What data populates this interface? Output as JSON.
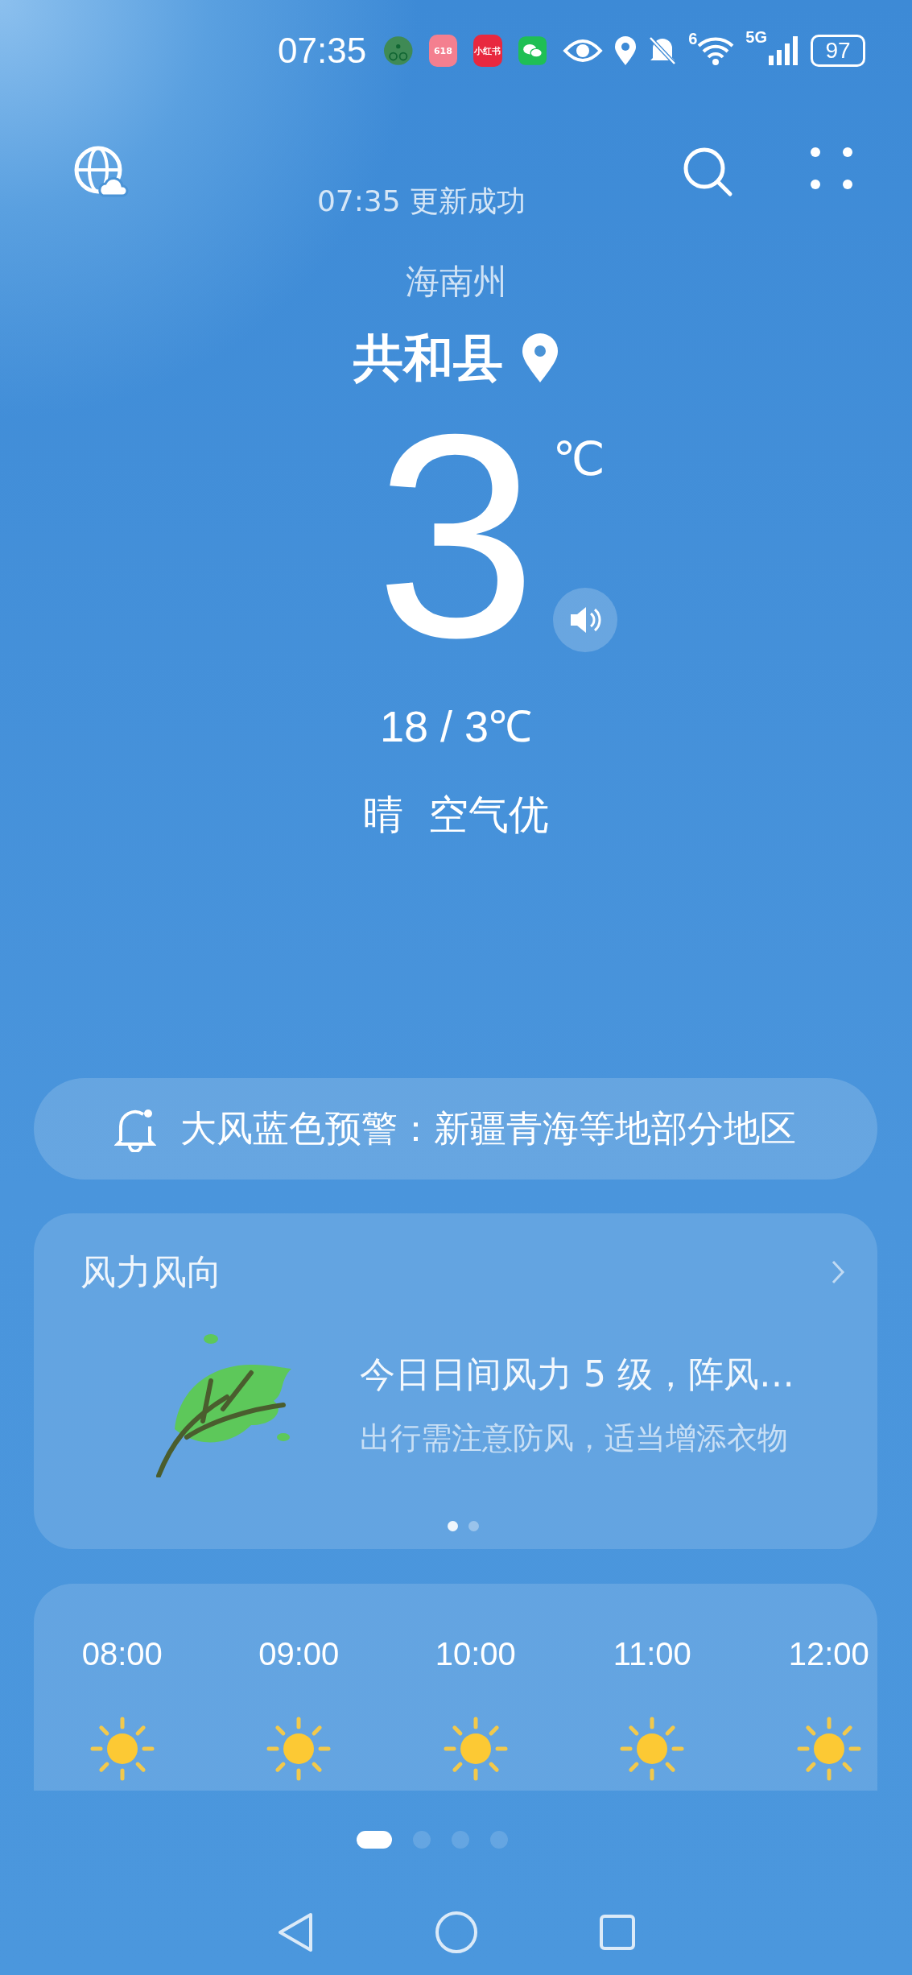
{
  "status_bar": {
    "time": "07:35",
    "notification_apps": [
      {
        "kind": "cycling"
      },
      {
        "kind": "promo",
        "label": "618"
      },
      {
        "kind": "notes",
        "label": "小红书"
      },
      {
        "kind": "chat"
      }
    ],
    "wifi_badge": "6",
    "network": "5G",
    "battery": "97"
  },
  "header": {
    "updated": "07:35 更新成功"
  },
  "location": {
    "region": "海南州",
    "county": "共和县"
  },
  "current": {
    "temperature": "3",
    "unit": "℃",
    "range": "18 / 3℃",
    "summary": "晴  空气优"
  },
  "alert": {
    "text": "大风蓝色预警：新疆青海等地部分地区"
  },
  "wind_card": {
    "title": "风力风向",
    "headline": "今日日间风力 5 级，阵风…",
    "advice": "出行需注意防风，适当增添衣物",
    "pages": [
      {
        "selected": true
      },
      {
        "selected": false
      }
    ]
  },
  "hourly": [
    {
      "time": "08:00",
      "kind": "sunny"
    },
    {
      "time": "09:00",
      "kind": "sunny"
    },
    {
      "time": "10:00",
      "kind": "sunny"
    },
    {
      "time": "11:00",
      "kind": "sunny"
    },
    {
      "time": "12:00",
      "kind": "sunny"
    }
  ],
  "pages": [
    {
      "selected": true
    },
    {
      "selected": false
    },
    {
      "selected": false
    },
    {
      "selected": false
    }
  ]
}
